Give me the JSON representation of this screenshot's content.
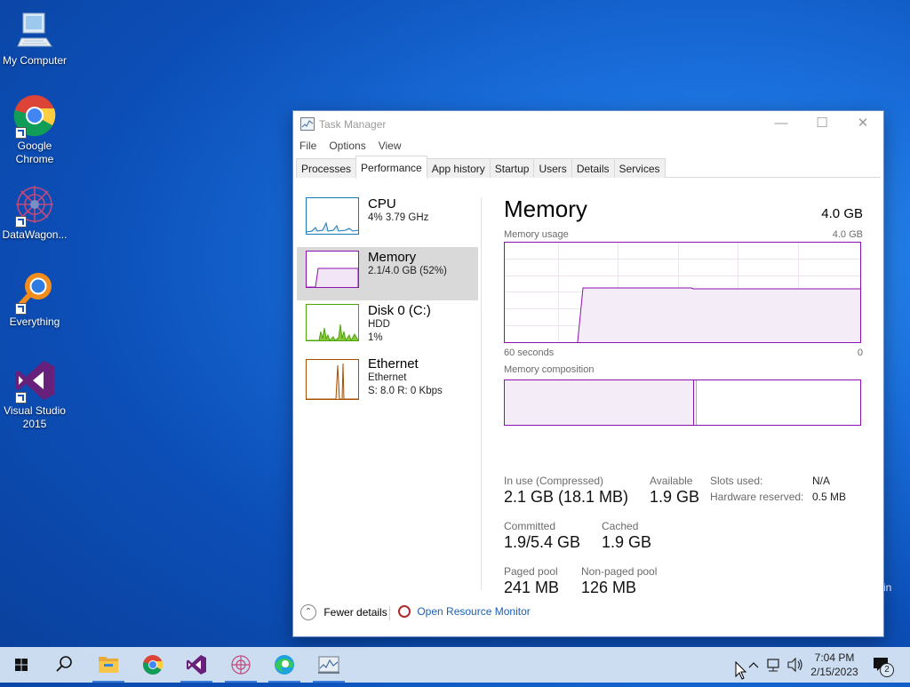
{
  "desktop": {
    "icons": [
      {
        "label": "My Computer",
        "icon": "computer-icon"
      },
      {
        "label": "Google Chrome",
        "icon": "chrome-icon"
      },
      {
        "label": "DataWagon...",
        "icon": "datawagon-icon"
      },
      {
        "label": "Everything",
        "icon": "everything-search-icon"
      },
      {
        "label": "Visual Studio 2015",
        "icon": "visual-studio-icon"
      }
    ],
    "peek_text": "in"
  },
  "window": {
    "title": "Task Manager",
    "menu": [
      "File",
      "Options",
      "View"
    ],
    "tabs": [
      "Processes",
      "Performance",
      "App history",
      "Startup",
      "Users",
      "Details",
      "Services"
    ],
    "active_tab": "Performance"
  },
  "perf_list": [
    {
      "name": "CPU",
      "line1": "4%  3.79 GHz",
      "line2": "",
      "color": "#1779ba"
    },
    {
      "name": "Memory",
      "line1": "2.1/4.0 GB (52%)",
      "line2": "",
      "color": "#8b12ae"
    },
    {
      "name": "Disk 0 (C:)",
      "line1": "HDD",
      "line2": "1%",
      "color": "#4da60c"
    },
    {
      "name": "Ethernet",
      "line1": "Ethernet",
      "line2": "S: 8.0  R: 0 Kbps",
      "color": "#a74f01"
    }
  ],
  "memory": {
    "title": "Memory",
    "total": "4.0 GB",
    "usage_label": "Memory usage",
    "usage_max": "4.0 GB",
    "time_left": "60 seconds",
    "time_right": "0",
    "composition_label": "Memory composition",
    "stats": {
      "in_use_label": "In use (Compressed)",
      "in_use_value": "2.1 GB (18.1 MB)",
      "available_label": "Available",
      "available_value": "1.9 GB",
      "committed_label": "Committed",
      "committed_value": "1.9/5.4 GB",
      "cached_label": "Cached",
      "cached_value": "1.9 GB",
      "paged_label": "Paged pool",
      "paged_value": "241 MB",
      "nonpaged_label": "Non-paged pool",
      "nonpaged_value": "126 MB",
      "slots_label": "Slots used:",
      "slots_value": "N/A",
      "hw_label": "Hardware reserved:",
      "hw_value": "0.5 MB"
    }
  },
  "footer": {
    "fewer_details": "Fewer details",
    "resource_monitor": "Open Resource Monitor"
  },
  "taskbar": {
    "apps": [
      "start-icon",
      "search-icon",
      "file-explorer-icon",
      "chrome-icon",
      "visual-studio-icon",
      "datawagon-icon",
      "edge-icon",
      "task-manager-icon"
    ],
    "time": "7:04 PM",
    "date": "2/15/2023",
    "notification_count": "2"
  },
  "colors": {
    "memory_accent": "#8b12ae",
    "link": "#1a5fb4",
    "taskbar_highlight": "#3a7bd5"
  }
}
